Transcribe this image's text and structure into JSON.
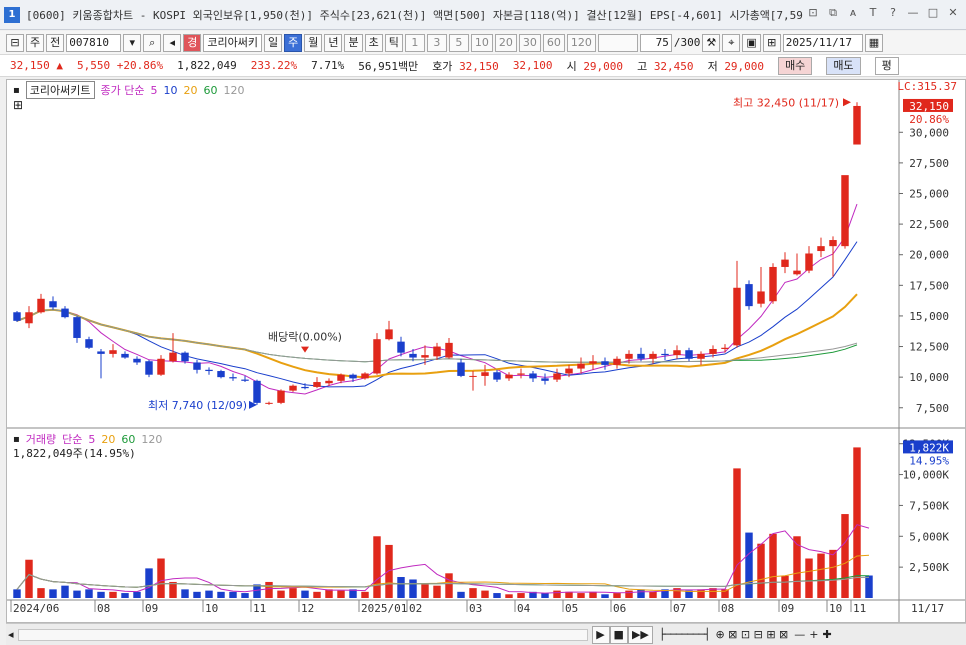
{
  "window": {
    "badge": "1",
    "title": "[0600] 키움종합차트 - KOSPI 외국인보유[1,950(천)] 주식수[23,621(천)] 액면[500] 자본금[118(억)] 결산[12월] EPS[-4,601] 시가총액[7,59",
    "controls": [
      "⊡",
      "⧉",
      "ᴀ",
      "T",
      "?",
      "—",
      "□",
      "✕"
    ]
  },
  "toolbar": {
    "period_select": "주",
    "prev_label": "전",
    "code": "007810",
    "mode_icon": "경",
    "stock_name": "코리아써키",
    "period_buttons": [
      {
        "label": "일",
        "active": false
      },
      {
        "label": "주",
        "active": true
      },
      {
        "label": "월",
        "active": false
      },
      {
        "label": "년",
        "active": false
      },
      {
        "label": "분",
        "active": false
      },
      {
        "label": "초",
        "active": false
      },
      {
        "label": "틱",
        "active": false
      }
    ],
    "intervals": [
      "1",
      "3",
      "5",
      "10",
      "20",
      "30",
      "60",
      "120"
    ],
    "count": "75",
    "count_max": "/300",
    "date": "2025/11/17"
  },
  "quote": {
    "price": "32,150",
    "arrow": "▲",
    "change": "5,550",
    "change_pct": "+20.86%",
    "volume": "1,822,049",
    "vol_ratio": "233.22%",
    "turnover": "7.71%",
    "amount": "56,951백만",
    "ask_label": "호가",
    "ask": "32,150",
    "bid": "32,100",
    "open_label": "시",
    "open": "29,000",
    "high_label": "고",
    "high": "32,450",
    "low_label": "저",
    "low": "29,000",
    "sell_label": "매수",
    "buy_label": "매도",
    "avg_label": "평"
  },
  "price_panel": {
    "stock_label": "코리아써키트",
    "ma_title": "종가 단순",
    "ma_periods": [
      {
        "label": "5",
        "color": "#c02ac0"
      },
      {
        "label": "10",
        "color": "#1a3fcc"
      },
      {
        "label": "20",
        "color": "#e8a010"
      },
      {
        "label": "60",
        "color": "#1e9a3a"
      },
      {
        "label": "120",
        "color": "#999999"
      }
    ],
    "lc_label": "LC:315.37",
    "last_price_tag": "32,150",
    "pct_tag": "20.86%",
    "high_annotation": "최고 32,450 (11/17)",
    "low_annotation": "최저 7,740 (12/09)",
    "dividend_annotation": "배당락(0.00%)",
    "y_ticks": [
      "30,000",
      "27,500",
      "25,000",
      "22,500",
      "20,000",
      "17,500",
      "15,000",
      "12,500",
      "10,000",
      "7,500"
    ]
  },
  "volume_panel": {
    "title": "거래량",
    "ma_title": "단순",
    "ma_periods": [
      {
        "label": "5",
        "color": "#c02ac0"
      },
      {
        "label": "20",
        "color": "#e8a010"
      },
      {
        "label": "60",
        "color": "#1e9a3a"
      },
      {
        "label": "120",
        "color": "#999999"
      }
    ],
    "current": "1,822,049주(14.95%)",
    "last_tag": "1,822K",
    "pct_tag": "14.95%",
    "y_ticks": [
      "12,500K",
      "10,000K",
      "7,500K",
      "5,000K",
      "2,500K"
    ]
  },
  "x_axis": {
    "labels": [
      "2024/06",
      "08",
      "09",
      "10",
      "11",
      "12",
      "2025/01",
      "02",
      "03",
      "04",
      "05",
      "06",
      "07",
      "08",
      "09",
      "10",
      "11"
    ],
    "right_label": "11/17"
  },
  "colors": {
    "up": "#e0281c",
    "down": "#1a3fcc",
    "ma5": "#c02ac0",
    "ma10": "#1a3fcc",
    "ma20": "#e8a010",
    "ma60": "#1e9a3a",
    "ma120": "#999999"
  },
  "chart_data": {
    "type": "candlestick",
    "ylim": [
      6500,
      32800
    ],
    "volume_ylim": [
      0,
      12800
    ],
    "volume_unit": "K",
    "candles": [
      {
        "o": 15300,
        "h": 15400,
        "l": 14500,
        "c": 14600
      },
      {
        "o": 14400,
        "h": 15800,
        "l": 14000,
        "c": 15300
      },
      {
        "o": 15300,
        "h": 16800,
        "l": 15200,
        "c": 16400
      },
      {
        "o": 16200,
        "h": 16600,
        "l": 15500,
        "c": 15700
      },
      {
        "o": 15600,
        "h": 15800,
        "l": 14800,
        "c": 14900
      },
      {
        "o": 14900,
        "h": 15000,
        "l": 12800,
        "c": 13200
      },
      {
        "o": 13100,
        "h": 13300,
        "l": 12300,
        "c": 12400
      },
      {
        "o": 12100,
        "h": 12300,
        "l": 9900,
        "c": 11900
      },
      {
        "o": 11900,
        "h": 12700,
        "l": 11600,
        "c": 12200
      },
      {
        "o": 11900,
        "h": 12100,
        "l": 11500,
        "c": 11600
      },
      {
        "o": 11500,
        "h": 11700,
        "l": 11000,
        "c": 11200
      },
      {
        "o": 11300,
        "h": 11400,
        "l": 10000,
        "c": 10200
      },
      {
        "o": 10200,
        "h": 11800,
        "l": 10100,
        "c": 11500
      },
      {
        "o": 11300,
        "h": 13600,
        "l": 11200,
        "c": 12000
      },
      {
        "o": 12000,
        "h": 12100,
        "l": 11100,
        "c": 11300
      },
      {
        "o": 11200,
        "h": 11400,
        "l": 10300,
        "c": 10600
      },
      {
        "o": 10600,
        "h": 10800,
        "l": 10200,
        "c": 10500
      },
      {
        "o": 10500,
        "h": 10600,
        "l": 9900,
        "c": 10000
      },
      {
        "o": 10000,
        "h": 10300,
        "l": 9700,
        "c": 9900
      },
      {
        "o": 9800,
        "h": 10100,
        "l": 9600,
        "c": 9700
      },
      {
        "o": 9700,
        "h": 9800,
        "l": 7740,
        "c": 7900
      },
      {
        "o": 7900,
        "h": 8000,
        "l": 7740,
        "c": 7900
      },
      {
        "o": 7900,
        "h": 9000,
        "l": 7800,
        "c": 8900
      },
      {
        "o": 8900,
        "h": 9400,
        "l": 8800,
        "c": 9300
      },
      {
        "o": 9200,
        "h": 9500,
        "l": 9000,
        "c": 9100
      },
      {
        "o": 9200,
        "h": 10000,
        "l": 9100,
        "c": 9600
      },
      {
        "o": 9500,
        "h": 9900,
        "l": 9300,
        "c": 9700
      },
      {
        "o": 9700,
        "h": 10300,
        "l": 9500,
        "c": 10200
      },
      {
        "o": 10200,
        "h": 10300,
        "l": 9600,
        "c": 9900
      },
      {
        "o": 9900,
        "h": 10400,
        "l": 9800,
        "c": 10300
      },
      {
        "o": 10300,
        "h": 13600,
        "l": 10200,
        "c": 13100
      },
      {
        "o": 13100,
        "h": 14600,
        "l": 13000,
        "c": 13900
      },
      {
        "o": 12900,
        "h": 13300,
        "l": 11700,
        "c": 12000
      },
      {
        "o": 11900,
        "h": 12300,
        "l": 11300,
        "c": 11600
      },
      {
        "o": 11600,
        "h": 12600,
        "l": 11000,
        "c": 11800
      },
      {
        "o": 11700,
        "h": 12800,
        "l": 11400,
        "c": 12500
      },
      {
        "o": 11600,
        "h": 13200,
        "l": 11500,
        "c": 12800
      },
      {
        "o": 11200,
        "h": 11500,
        "l": 10000,
        "c": 10100
      },
      {
        "o": 10100,
        "h": 10500,
        "l": 8900,
        "c": 10100
      },
      {
        "o": 10100,
        "h": 11000,
        "l": 9300,
        "c": 10400
      },
      {
        "o": 10400,
        "h": 10600,
        "l": 9600,
        "c": 9800
      },
      {
        "o": 9900,
        "h": 10400,
        "l": 9700,
        "c": 10200
      },
      {
        "o": 10200,
        "h": 10700,
        "l": 9900,
        "c": 10300
      },
      {
        "o": 10300,
        "h": 10500,
        "l": 9600,
        "c": 9900
      },
      {
        "o": 9900,
        "h": 10300,
        "l": 9400,
        "c": 9700
      },
      {
        "o": 9800,
        "h": 10700,
        "l": 9600,
        "c": 10300
      },
      {
        "o": 10300,
        "h": 11000,
        "l": 10000,
        "c": 10700
      },
      {
        "o": 10700,
        "h": 11600,
        "l": 10300,
        "c": 11100
      },
      {
        "o": 11100,
        "h": 11800,
        "l": 10600,
        "c": 11300
      },
      {
        "o": 11300,
        "h": 11600,
        "l": 10600,
        "c": 11000
      },
      {
        "o": 11000,
        "h": 11700,
        "l": 10700,
        "c": 11500
      },
      {
        "o": 11500,
        "h": 12200,
        "l": 11100,
        "c": 11900
      },
      {
        "o": 11900,
        "h": 12400,
        "l": 11300,
        "c": 11500
      },
      {
        "o": 11500,
        "h": 12100,
        "l": 11100,
        "c": 11900
      },
      {
        "o": 11900,
        "h": 12300,
        "l": 11400,
        "c": 11800
      },
      {
        "o": 11800,
        "h": 12600,
        "l": 11500,
        "c": 12200
      },
      {
        "o": 12200,
        "h": 12400,
        "l": 11300,
        "c": 11500
      },
      {
        "o": 11500,
        "h": 12100,
        "l": 11000,
        "c": 11900
      },
      {
        "o": 11900,
        "h": 12600,
        "l": 11600,
        "c": 12300
      },
      {
        "o": 12300,
        "h": 12700,
        "l": 12000,
        "c": 12400
      },
      {
        "o": 12600,
        "h": 19500,
        "l": 12400,
        "c": 17300
      },
      {
        "o": 17600,
        "h": 17900,
        "l": 15500,
        "c": 15800
      },
      {
        "o": 16000,
        "h": 19000,
        "l": 15700,
        "c": 17000
      },
      {
        "o": 16200,
        "h": 19300,
        "l": 16000,
        "c": 19000
      },
      {
        "o": 19000,
        "h": 20200,
        "l": 18500,
        "c": 19600
      },
      {
        "o": 18400,
        "h": 20100,
        "l": 18300,
        "c": 18700
      },
      {
        "o": 18700,
        "h": 20700,
        "l": 18500,
        "c": 20100
      },
      {
        "o": 20300,
        "h": 21400,
        "l": 19800,
        "c": 20700
      },
      {
        "o": 20700,
        "h": 21500,
        "l": 18200,
        "c": 21200
      },
      {
        "o": 20700,
        "h": 24500,
        "l": 20500,
        "c": 26500
      },
      {
        "o": 29000,
        "h": 32450,
        "l": 29000,
        "c": 32150
      }
    ],
    "volumes": [
      700,
      3100,
      800,
      700,
      1000,
      600,
      700,
      500,
      500,
      400,
      500,
      2400,
      3200,
      1300,
      700,
      500,
      600,
      500,
      500,
      400,
      1100,
      1300,
      600,
      800,
      600,
      500,
      700,
      600,
      700,
      500,
      5000,
      4300,
      1700,
      1500,
      1100,
      1000,
      2000,
      500,
      800,
      600,
      400,
      300,
      400,
      500,
      400,
      600,
      500,
      400,
      500,
      300,
      400,
      600,
      700,
      500,
      700,
      800,
      600,
      700,
      800,
      700,
      10500,
      5300,
      4400,
      5200,
      1800,
      5000,
      3200,
      3600,
      3900,
      6800,
      12200,
      1822
    ]
  }
}
